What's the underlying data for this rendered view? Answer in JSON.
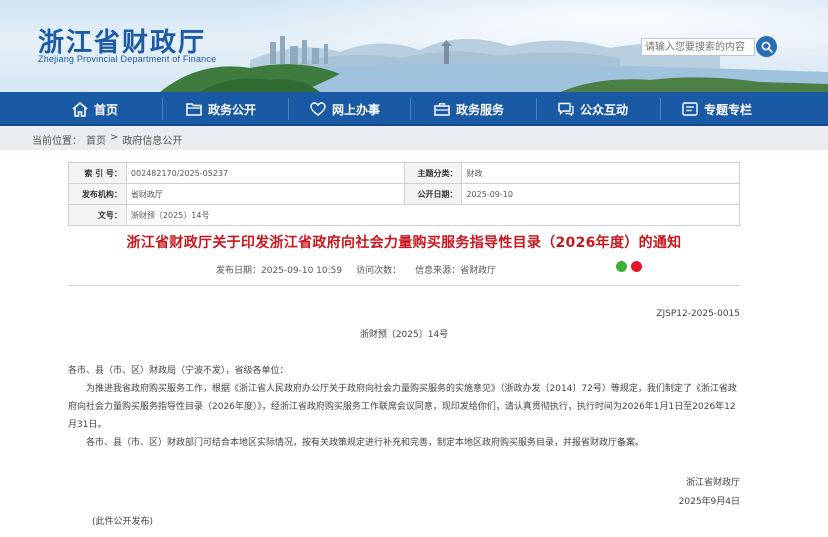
{
  "header": {
    "title": "浙江省财政厅",
    "subtitle": "Zhejiang Provincial Department of Finance",
    "search_placeholder": "请输入您要搜索的内容"
  },
  "nav": {
    "items": [
      {
        "label": "首页",
        "icon": "home-icon"
      },
      {
        "label": "政务公开",
        "icon": "folder-icon"
      },
      {
        "label": "网上办事",
        "icon": "heart-hands-icon"
      },
      {
        "label": "政务服务",
        "icon": "briefcase-icon"
      },
      {
        "label": "公众互动",
        "icon": "chat-icon"
      },
      {
        "label": "专题专栏",
        "icon": "column-icon"
      }
    ]
  },
  "breadcrumb": {
    "label": "当前位置：",
    "items": [
      "首页",
      "政府信息公开"
    ],
    "separator": ">"
  },
  "info": {
    "index_label": "索 引 号：",
    "index_value": "002482170/2025-05237",
    "category_label": "主题分类：",
    "category_value": "财政",
    "issuer_label": "发布机构：",
    "issuer_value": "省财政厅",
    "date_label": "公开日期：",
    "date_value": "2025-09-10",
    "docnum_label": "文号：",
    "docnum_value": "浙财预〔2025〕14号"
  },
  "article": {
    "title": "浙江省财政厅关于印发浙江省政府向社会力量购买服务指导性目录（2026年度）的通知",
    "publish_date": "发布日期：2025-09-10 10:59",
    "visits": "访问次数：",
    "source": "信息来源：省财政厅",
    "code": "ZJSP12-2025-0015",
    "doc_number": "浙财预〔2025〕14号",
    "salutation": "各市、县（市、区）财政局（宁波不发），省级各单位：",
    "paragraph1": "为推进我省政府购买服务工作，根据《浙江省人民政府办公厅关于政府向社会力量购买服务的实施意见》（浙政办发〔2014〕72号）等规定，我们制定了《浙江省政府向社会力量购买服务指导性目录（2026年度）》，经浙江省政府购买服务工作联席会议同意，现印发给你们，请认真贯彻执行，执行时间为2026年1月1日至2026年12月31日。",
    "paragraph2": "各市、县（市、区）财政部门可结合本地区实际情况，按有关政策规定进行补充和完善，制定本地区政府购买服务目录，并报省财政厅备案。",
    "signature": "浙江省财政厅",
    "sign_date": "2025年9月4日",
    "note": "(此件公开发布)"
  },
  "colors": {
    "nav_bg": "#1a5aa4",
    "title_red": "#c7161d",
    "brand_blue": "#1c5aa6"
  }
}
